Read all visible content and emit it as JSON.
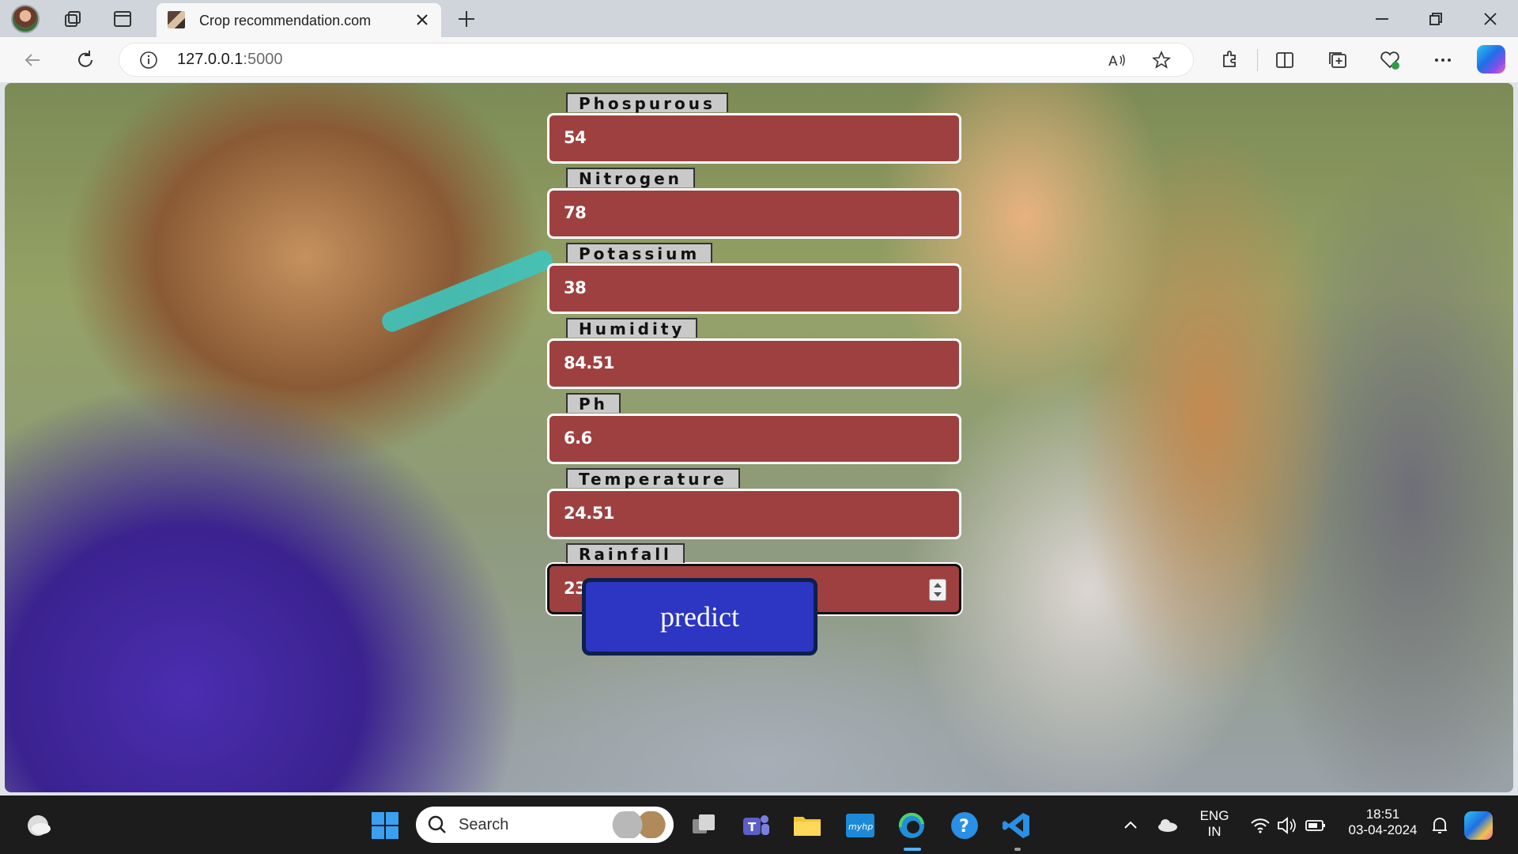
{
  "browser": {
    "tab_title": "Crop recommendation.com",
    "url_host": "127.0.0.1",
    "url_port": ":5000"
  },
  "form": {
    "fields": [
      {
        "label": "Phospurous",
        "value": "54"
      },
      {
        "label": "Nitrogen",
        "value": "78"
      },
      {
        "label": "Potassium",
        "value": "38"
      },
      {
        "label": "Humidity",
        "value": "84.51"
      },
      {
        "label": "Ph",
        "value": "6.6"
      },
      {
        "label": "Temperature",
        "value": "24.51"
      },
      {
        "label": "Rainfall",
        "value": "230.51"
      }
    ],
    "predict_label": "predict"
  },
  "taskbar": {
    "search_label": "Search",
    "lang_line1": "ENG",
    "lang_line2": "IN",
    "time": "18:51",
    "date": "03-04-2024"
  },
  "colors": {
    "field_bg": "#9e4040",
    "button_bg": "#2c36c2",
    "legend_bg": "#c9c9c9"
  }
}
